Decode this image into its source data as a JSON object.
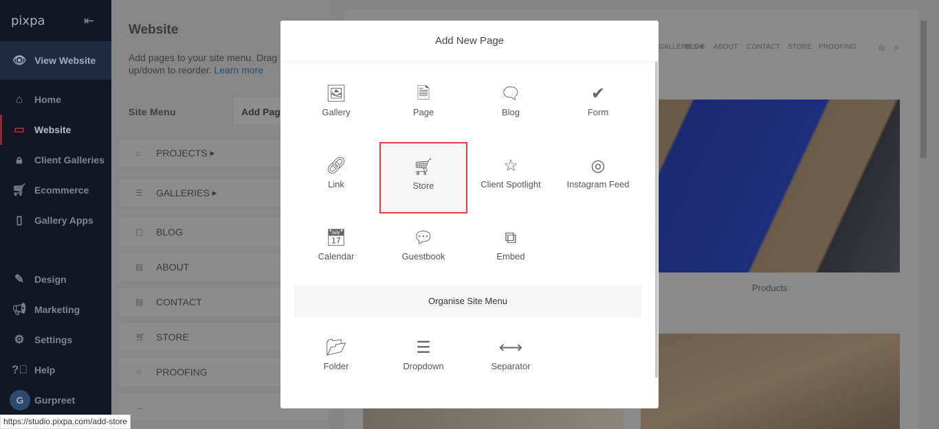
{
  "sidebar": {
    "logo": "pixpa",
    "view_website": "View Website",
    "items": [
      {
        "label": "Home",
        "icon": "home-icon"
      },
      {
        "label": "Website",
        "icon": "browser-icon"
      },
      {
        "label": "Client Galleries",
        "icon": "lock-icon"
      },
      {
        "label": "Ecommerce",
        "icon": "cart-icon"
      },
      {
        "label": "Gallery Apps",
        "icon": "mobile-icon"
      },
      {
        "label": "Design",
        "icon": "design-icon"
      },
      {
        "label": "Marketing",
        "icon": "megaphone-icon"
      },
      {
        "label": "Settings",
        "icon": "gear-icon"
      },
      {
        "label": "Help",
        "icon": "help-icon"
      }
    ],
    "user": {
      "initial": "G",
      "name": "Gurpreet"
    }
  },
  "panel": {
    "title": "Website",
    "desc": "Add pages to your site menu. Drag pages up/down to reorder.",
    "learn_more": "Learn more",
    "site_menu": "Site Menu",
    "add_page": "Add Page",
    "menu": [
      "PROJECTS",
      "GALLERIES",
      "BLOG",
      "ABOUT",
      "CONTACT",
      "STORE",
      "PROOFING"
    ],
    "separator": "↔"
  },
  "preview": {
    "nav": [
      "GALLERIES",
      "BLOG",
      "ABOUT",
      "CONTACT",
      "STORE",
      "PROOFING"
    ],
    "products": "Products"
  },
  "modal": {
    "title": "Add New Page",
    "tiles": [
      {
        "label": "Gallery",
        "icon": "image-icon"
      },
      {
        "label": "Page",
        "icon": "document-icon"
      },
      {
        "label": "Blog",
        "icon": "comment-icon"
      },
      {
        "label": "Form",
        "icon": "double-check-icon"
      },
      {
        "label": "Link",
        "icon": "link-icon"
      },
      {
        "label": "Store",
        "icon": "cart-icon",
        "selected": true
      },
      {
        "label": "Client Spotlight",
        "icon": "star-icon"
      },
      {
        "label": "Instagram Feed",
        "icon": "instagram-icon"
      },
      {
        "label": "Calendar",
        "icon": "calendar-plus-icon"
      },
      {
        "label": "Guestbook",
        "icon": "chat-bubble-icon"
      },
      {
        "label": "Embed",
        "icon": "external-icon"
      }
    ],
    "organise": "Organise Site Menu",
    "org_tiles": [
      {
        "label": "Folder",
        "icon": "folder-icon"
      },
      {
        "label": "Dropdown",
        "icon": "menu-lines-icon"
      },
      {
        "label": "Separator",
        "icon": "arrows-horizontal-icon"
      }
    ]
  },
  "status_url": "https://studio.pixpa.com/add-store",
  "colors": {
    "highlight": "#e53a3f",
    "sidebar": "#111725"
  }
}
